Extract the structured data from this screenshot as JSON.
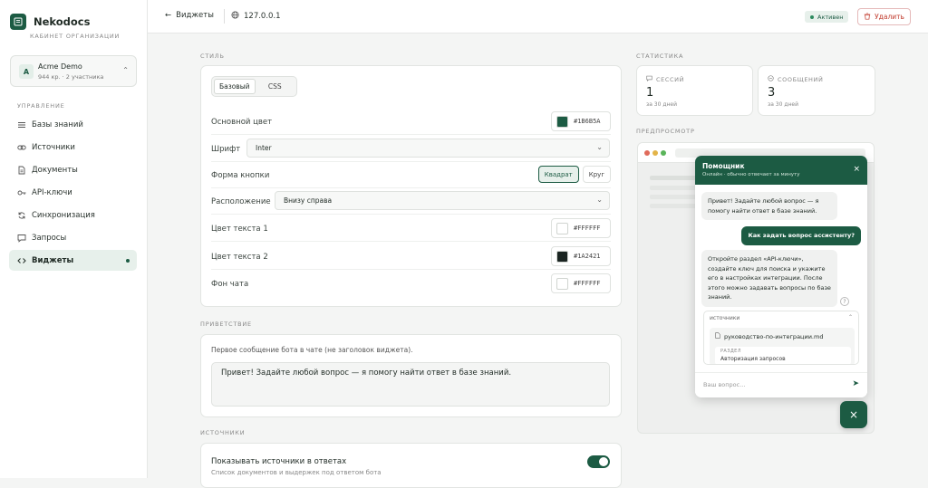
{
  "brand": {
    "name": "Nekodocs",
    "subtitle": "КАБИНЕТ ОРГАНИЗАЦИИ"
  },
  "org": {
    "avatar": "A",
    "name": "Acme Demo",
    "meta": "944 кр. · 2 участника"
  },
  "nav": {
    "heading": "УПРАВЛЕНИЕ",
    "items": [
      {
        "label": "Базы знаний",
        "icon": "database-icon"
      },
      {
        "label": "Источники",
        "icon": "link-icon"
      },
      {
        "label": "Документы",
        "icon": "document-icon"
      },
      {
        "label": "API-ключи",
        "icon": "key-icon"
      },
      {
        "label": "Синхронизация",
        "icon": "sync-icon"
      },
      {
        "label": "Запросы",
        "icon": "chat-icon"
      },
      {
        "label": "Виджеты",
        "icon": "code-icon",
        "active": true
      }
    ]
  },
  "topbar": {
    "back_label": "Виджеты",
    "host": "127.0.0.1",
    "status": "Активен",
    "delete_label": "Удалить"
  },
  "style": {
    "section": "СТИЛЬ",
    "tabs": [
      "Базовый",
      "CSS"
    ],
    "primary_label": "Основной цвет",
    "primary_value": "#1B6B5A",
    "primary_color": "#1c5b43",
    "font_label": "Шрифт",
    "font_value": "Inter",
    "shape_label": "Форма кнопки",
    "shape_options": [
      "Квадрат",
      "Круг"
    ],
    "position_label": "Расположение",
    "position_value": "Внизу справа",
    "text1_label": "Цвет текста 1",
    "text1_value": "#FFFFFF",
    "text2_label": "Цвет текста 2",
    "text2_value": "#1A2421",
    "bg_label": "Фон чата",
    "bg_value": "#FFFFFF"
  },
  "greeting": {
    "section": "ПРИВЕТСТВИЕ",
    "hint": "Первое сообщение бота в чате (не заголовок виджета).",
    "value": "Привет! Задайте любой вопрос — я помогу найти ответ в базе знаний."
  },
  "sources": {
    "section": "ИСТОЧНИКИ",
    "title": "Показывать источники в ответах",
    "subtitle": "Список документов и выдержек под ответом бота"
  },
  "stats": {
    "section": "СТАТИСТИКА",
    "sessions_label": "СЕССИЙ",
    "sessions_value": "1",
    "sessions_period": "за 30 дней",
    "messages_label": "СООБЩЕНИЙ",
    "messages_value": "3",
    "messages_period": "за 30 дней"
  },
  "preview": {
    "section": "ПРЕДПРОСМОТР",
    "chat_title": "Помощник",
    "chat_status": "Онлайн · обычно отвечает за минуту",
    "bot_msg1": "Привет! Задайте любой вопрос — я помогу найти ответ в базе знаний.",
    "user_msg": "Как задать вопрос ассистенту?",
    "bot_msg2": "Откройте раздел «API-ключи», создайте ключ для поиска и укажите его в настройках интеграции. После этого можно задавать вопросы по базе знаний.",
    "sources_header": "источники",
    "source_file": "руководство-по-интеграции.md",
    "source_section_label": "РАЗДЕЛ",
    "source_section": "Авторизация запросов",
    "input_placeholder": "Ваш вопрос..."
  }
}
